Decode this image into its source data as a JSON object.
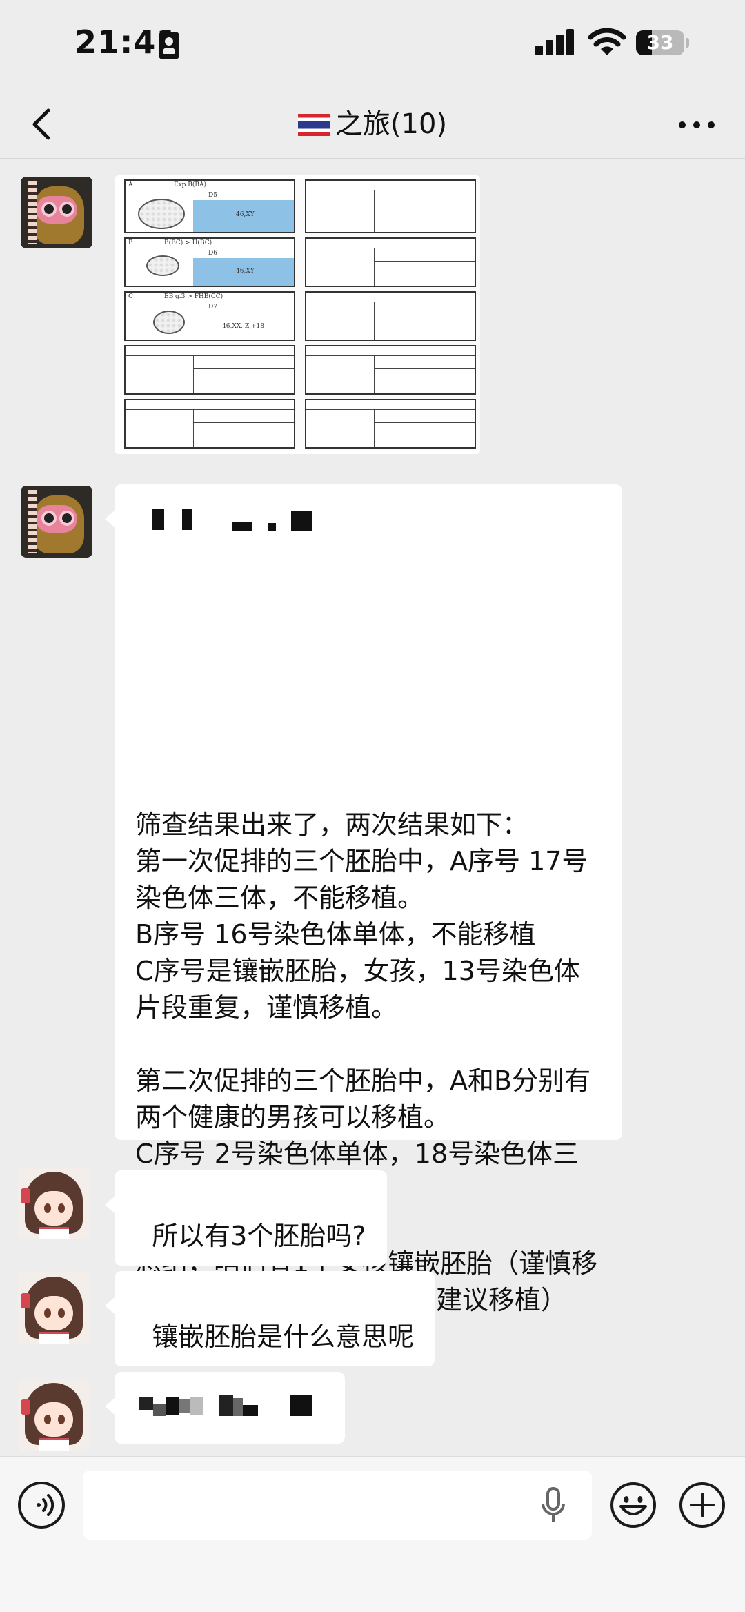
{
  "status_bar": {
    "time": "21:41",
    "battery_level": "33",
    "battery_fraction": 0.33
  },
  "nav": {
    "flag": "thailand-flag-icon",
    "title": "之旅(10)",
    "back_icon": "chevron-left-icon",
    "more_icon": "ellipsis-icon"
  },
  "messages": [
    {
      "sender": "owl-avatar",
      "type": "image",
      "image_text": [
        "Exp.B(BA)",
        "D5",
        "46,XY",
        "B(BC) > H(BC)",
        "D6",
        "46,XY",
        "EB g.3 > FHB(CC)",
        "D7",
        "46,XX,-Z,+18"
      ]
    },
    {
      "sender": "owl-avatar",
      "type": "text",
      "redacted_header": true,
      "text": "筛查结果出来了，两次结果如下：\n第一次促排的三个胚胎中，A序号 17号染色体三体，不能移植。\nB序号 16号染色体单体，不能移植\nC序号是镶嵌胚胎，女孩，13号染色体片段重复，谨慎移植。\n\n第二次促排的三个胚胎中，A和B分别有两个健康的男孩可以移植。\nC序号 2号染色体单体，18号染色体三体，不能移植。\n\n总结，咱们有1个女孩镶嵌胚胎（谨慎移植）+2个健康男孩移植（建议移植）"
    },
    {
      "sender": "girl-avatar",
      "type": "text",
      "text": "所以有3个胚胎吗?"
    },
    {
      "sender": "girl-avatar",
      "type": "text",
      "text": "镶嵌胚胎是什么意思呢"
    },
    {
      "sender": "girl-avatar",
      "type": "redacted"
    }
  ],
  "input_bar": {
    "voice_icon": "voice-icon",
    "placeholder": "",
    "mic_icon": "mic-icon",
    "emoji_icon": "emoji-icon",
    "plus_icon": "plus-icon"
  }
}
